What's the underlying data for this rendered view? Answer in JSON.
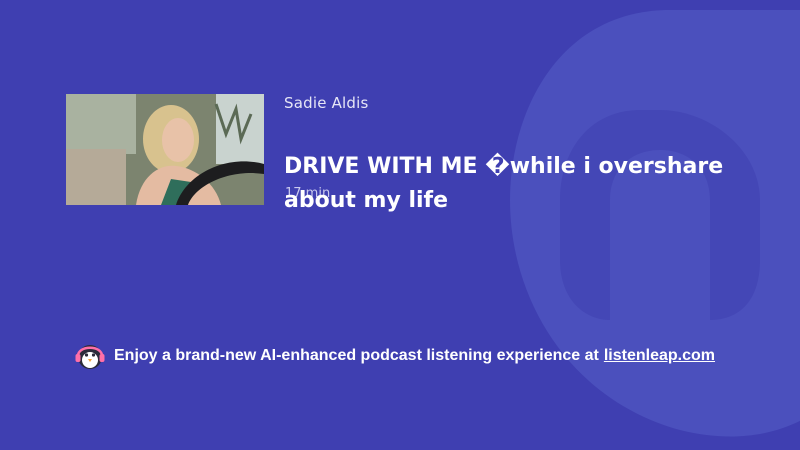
{
  "episode": {
    "author": "Sadie Aldis",
    "title": "DRIVE WITH ME �while i overshare about my life",
    "duration": "17 min"
  },
  "promo": {
    "text": "Enjoy a brand-new AI-enhanced podcast listening experience at",
    "link": "listenleap.com"
  },
  "icons": {
    "background": "listenleap-logo-watermark-icon",
    "mascot": "penguin-headphones-icon"
  },
  "colors": {
    "background": "#3f3fb1",
    "text": "#ffffff"
  }
}
